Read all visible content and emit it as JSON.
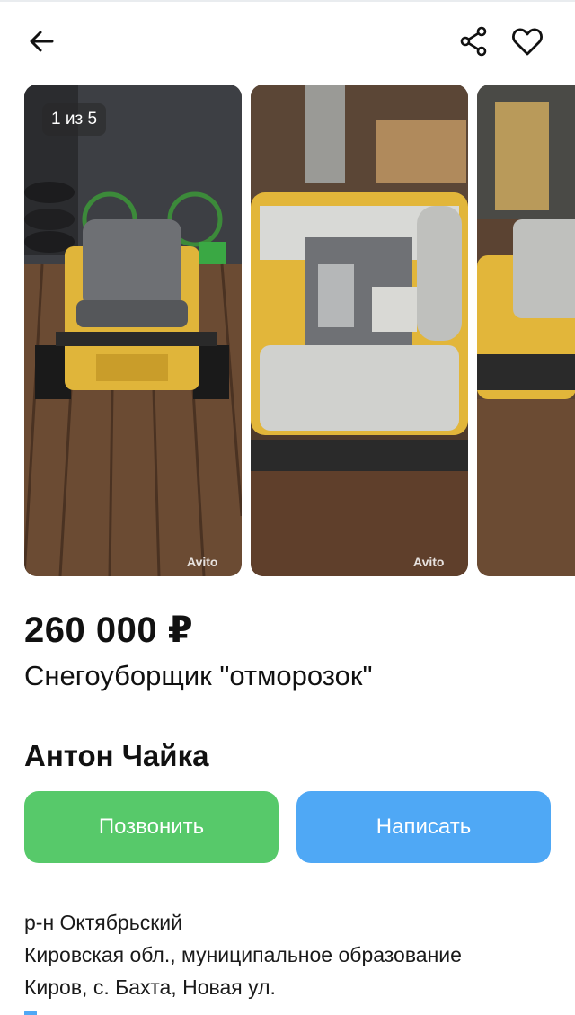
{
  "gallery": {
    "counter": "1 из 5",
    "watermark_1": "Avito",
    "watermark_2": "Avito",
    "photos": [
      {
        "alt": "tracked snow machine with seat, rear view"
      },
      {
        "alt": "snow machine engine and controls, ОТМорозок label"
      },
      {
        "alt": "snow machine side view"
      }
    ]
  },
  "listing": {
    "price": "260 000 ₽",
    "title": "Снегоуборщик \"отморозок\""
  },
  "seller": {
    "name": "Антон Чайка"
  },
  "actions": {
    "call_label": "Позвонить",
    "write_label": "Написать"
  },
  "address": {
    "line_1": "р-н Октябрьский",
    "line_2": "Кировская обл., муниципальное образование",
    "line_3": "Киров, с. Бахта, Новая ул."
  },
  "colors": {
    "call_button": "#57c96a",
    "write_button": "#4fa8f5"
  },
  "icons": {
    "back": "arrow-left-icon",
    "share": "share-icon",
    "favorite": "heart-icon"
  }
}
